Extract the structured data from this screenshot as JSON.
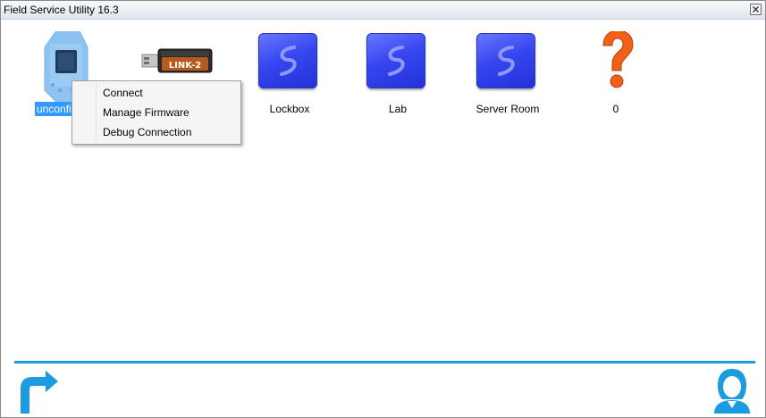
{
  "window": {
    "title": "Field Service Utility 16.3"
  },
  "devices": [
    {
      "label": "unconfigured",
      "icon": "usb-dongle-icon",
      "selected": true
    },
    {
      "label": "",
      "icon": "link2-adapter-icon",
      "badge": "LINK-2"
    },
    {
      "label": "Lockbox",
      "icon": "blue-tile-icon"
    },
    {
      "label": "Lab",
      "icon": "blue-tile-icon"
    },
    {
      "label": "Server Room",
      "icon": "blue-tile-icon"
    },
    {
      "label": "0",
      "icon": "question-mark-icon"
    }
  ],
  "context_menu": {
    "items": [
      {
        "label": "Connect"
      },
      {
        "label": "Manage Firmware"
      },
      {
        "label": "Debug Connection"
      }
    ]
  },
  "footer": {
    "back_icon": "back-arrow-icon",
    "support_icon": "support-agent-icon"
  },
  "colors": {
    "accent": "#1c9be0",
    "tile": "#3747f0",
    "selection": "#3399ff",
    "question": "#f06018"
  }
}
